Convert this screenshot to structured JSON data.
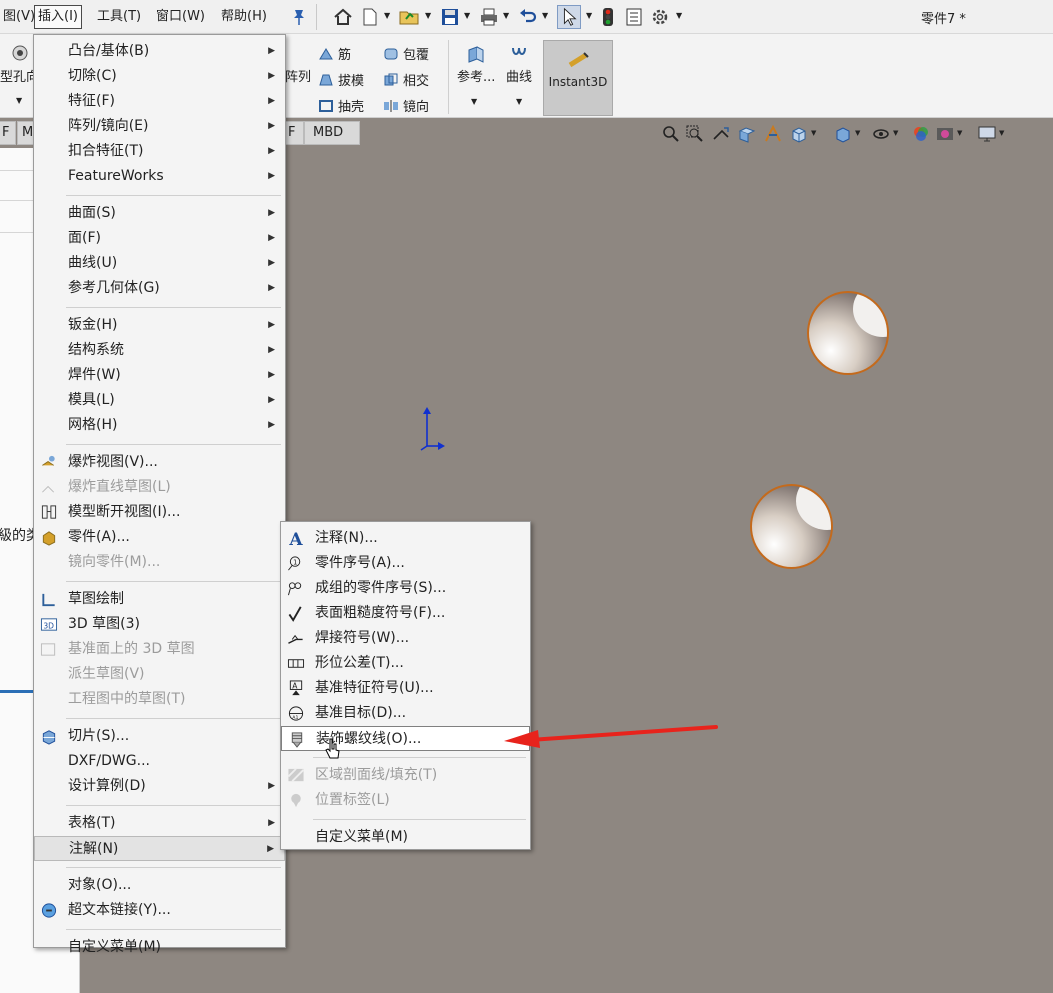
{
  "menubar": {
    "view_partial": "图(V)",
    "insert": "插入(I)",
    "tools": "工具(T)",
    "window": "窗口(W)",
    "help": "帮助(H)",
    "pin_icon": "pin-icon"
  },
  "document_title": "零件7 *",
  "ribbon": {
    "hole_wizard_partial": "型孔向",
    "pattern_partial": "阵列",
    "rib": "筋",
    "wrap": "包覆",
    "draft": "拔模",
    "intersect": "相交",
    "shell": "抽壳",
    "mirror": "镜向",
    "reference": "参考...",
    "curves": "曲线",
    "instant3d": "Instant3D"
  },
  "tabs": {
    "partial_left": "F",
    "m_partial": "M",
    "mbd": "MBD",
    "f_partial": "F"
  },
  "left_panel_partial": "級的类",
  "insert_menu": [
    {
      "label": "凸台/基体(B)",
      "submenu": true
    },
    {
      "label": "切除(C)",
      "submenu": true
    },
    {
      "label": "特征(F)",
      "submenu": true
    },
    {
      "label": "阵列/镜向(E)",
      "submenu": true
    },
    {
      "label": "扣合特征(T)",
      "submenu": true
    },
    {
      "label": "FeatureWorks",
      "submenu": true
    },
    {
      "label": "曲面(S)",
      "submenu": true
    },
    {
      "label": "面(F)",
      "submenu": true
    },
    {
      "label": "曲线(U)",
      "submenu": true
    },
    {
      "label": "参考几何体(G)",
      "submenu": true
    },
    {
      "label": "钣金(H)",
      "submenu": true
    },
    {
      "label": "结构系统",
      "submenu": true
    },
    {
      "label": "焊件(W)",
      "submenu": true
    },
    {
      "label": "模具(L)",
      "submenu": true
    },
    {
      "label": "网格(H)",
      "submenu": true
    },
    {
      "label": "爆炸视图(V)...",
      "icon": "explode-view-icon"
    },
    {
      "label": "爆炸直线草图(L)",
      "disabled": true,
      "icon": "explode-line-sketch-icon"
    },
    {
      "label": "模型断开视图(I)...",
      "icon": "break-view-icon"
    },
    {
      "label": "零件(A)...",
      "icon": "part-icon"
    },
    {
      "label": "镜向零件(M)...",
      "disabled": true
    },
    {
      "label": "草图绘制",
      "icon": "sketch-icon"
    },
    {
      "label": "3D 草图(3)",
      "icon": "3d-sketch-icon"
    },
    {
      "label": "基准面上的 3D 草图",
      "disabled": true,
      "icon": "3d-sketch-on-plane-icon"
    },
    {
      "label": "派生草图(V)",
      "disabled": true
    },
    {
      "label": "工程图中的草图(T)",
      "disabled": true
    },
    {
      "label": "切片(S)...",
      "icon": "slice-icon"
    },
    {
      "label": "DXF/DWG..."
    },
    {
      "label": "设计算例(D)",
      "submenu": true
    },
    {
      "label": "表格(T)",
      "submenu": true
    },
    {
      "label": "注解(N)",
      "submenu": true,
      "highlighted": true
    },
    {
      "label": "对象(O)..."
    },
    {
      "label": "超文本链接(Y)...",
      "icon": "hyperlink-icon"
    },
    {
      "label": "自定义菜单(M)"
    }
  ],
  "annotation_submenu": [
    {
      "label": "注释(N)...",
      "icon": "note-icon"
    },
    {
      "label": "零件序号(A)...",
      "icon": "balloon-icon"
    },
    {
      "label": "成组的零件序号(S)...",
      "icon": "stacked-balloon-icon"
    },
    {
      "label": "表面粗糙度符号(F)...",
      "icon": "surface-finish-icon"
    },
    {
      "label": "焊接符号(W)...",
      "icon": "weld-symbol-icon"
    },
    {
      "label": "形位公差(T)...",
      "icon": "geometric-tolerance-icon"
    },
    {
      "label": "基准特征符号(U)...",
      "icon": "datum-feature-icon"
    },
    {
      "label": "基准目标(D)...",
      "icon": "datum-target-icon"
    },
    {
      "label": "装饰螺纹线(O)...",
      "icon": "cosmetic-thread-icon",
      "highlighted": true
    },
    {
      "label": "区域剖面线/填充(T)",
      "icon": "area-hatch-icon",
      "disabled": true
    },
    {
      "label": "位置标签(L)",
      "icon": "location-label-icon",
      "disabled": true
    },
    {
      "label": "自定义菜单(M)"
    }
  ],
  "colors": {
    "viewport_bg": "#8e8781",
    "annotation_arrow": "#e8231c",
    "hole_edge": "#c46a1c",
    "triad_axis": "#1030d0"
  }
}
